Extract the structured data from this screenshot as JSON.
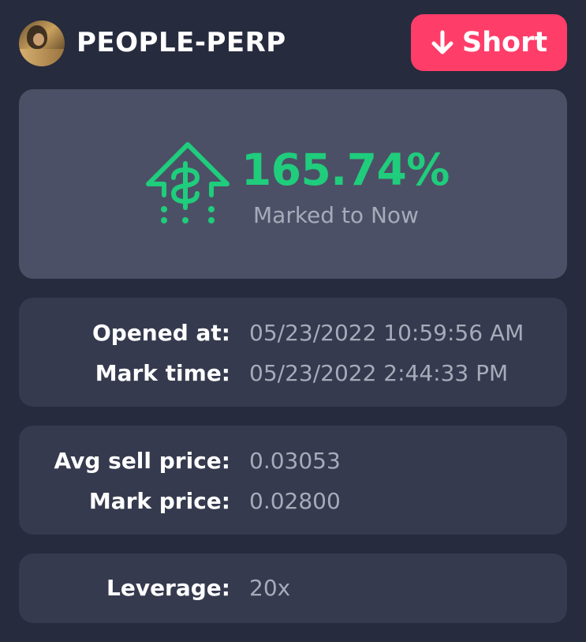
{
  "header": {
    "pair": "PEOPLE-PERP",
    "direction_label": "Short",
    "direction_icon": "arrow-down-icon",
    "direction_color": "#ff3d69"
  },
  "pnl": {
    "value": "165.74%",
    "caption": "Marked to Now",
    "icon": "money-up-arrow-icon",
    "color": "#1fcd7c"
  },
  "times": [
    {
      "label": "Opened at:",
      "value": "05/23/2022 10:59:56 AM"
    },
    {
      "label": "Mark time:",
      "value": "05/23/2022 2:44:33 PM"
    }
  ],
  "prices": [
    {
      "label": "Avg sell price:",
      "value": "0.03053"
    },
    {
      "label": "Mark price:",
      "value": "0.02800"
    }
  ],
  "leverage": {
    "label": "Leverage:",
    "value": "20x"
  }
}
